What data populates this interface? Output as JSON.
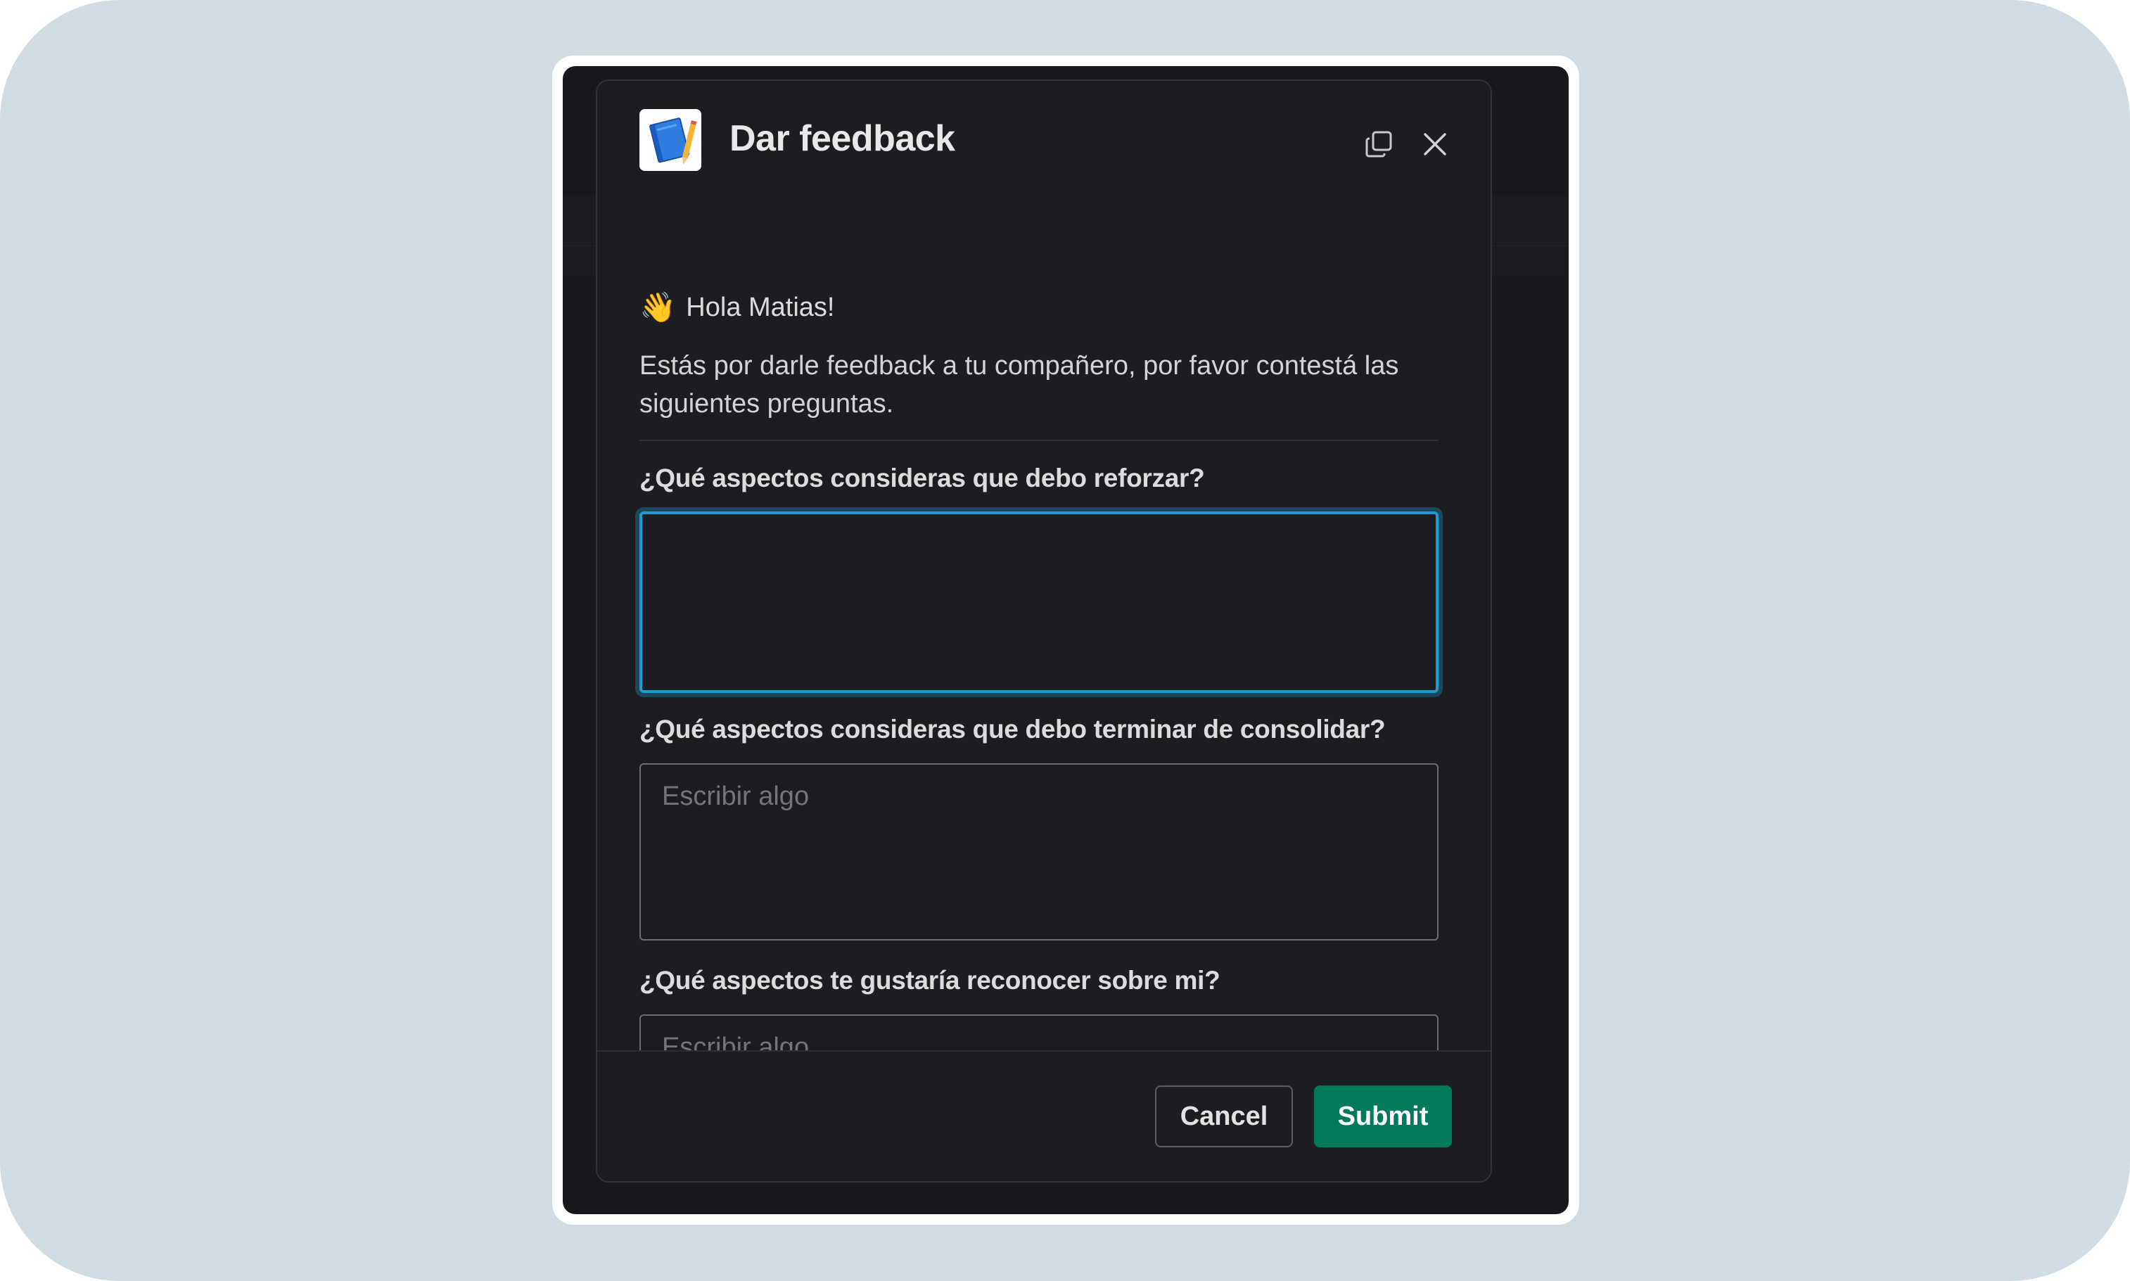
{
  "modal": {
    "title": "Dar feedback",
    "greeting": "Hola Matias!",
    "greeting_emoji": "👋",
    "intro": "Estás por darle feedback a tu compañero, por favor contestá las siguientes preguntas.",
    "questions": [
      {
        "label": "¿Qué aspectos consideras que debo reforzar?",
        "value": "",
        "placeholder": ""
      },
      {
        "label": "¿Qué aspectos consideras que debo terminar de consolidar?",
        "value": "",
        "placeholder": "Escribir algo"
      },
      {
        "label": "¿Qué aspectos te gustaría reconocer sobre mi?",
        "value": "",
        "placeholder": "Escribir algo"
      }
    ],
    "cancel_label": "Cancel",
    "submit_label": "Submit",
    "icons": {
      "app": "notebook-icon",
      "popout": "popout-icon",
      "close": "close-icon"
    },
    "colors": {
      "submit_bg": "#007a5a",
      "focus_ring": "#1d9bd1",
      "modal_bg": "#1b1d21"
    }
  }
}
